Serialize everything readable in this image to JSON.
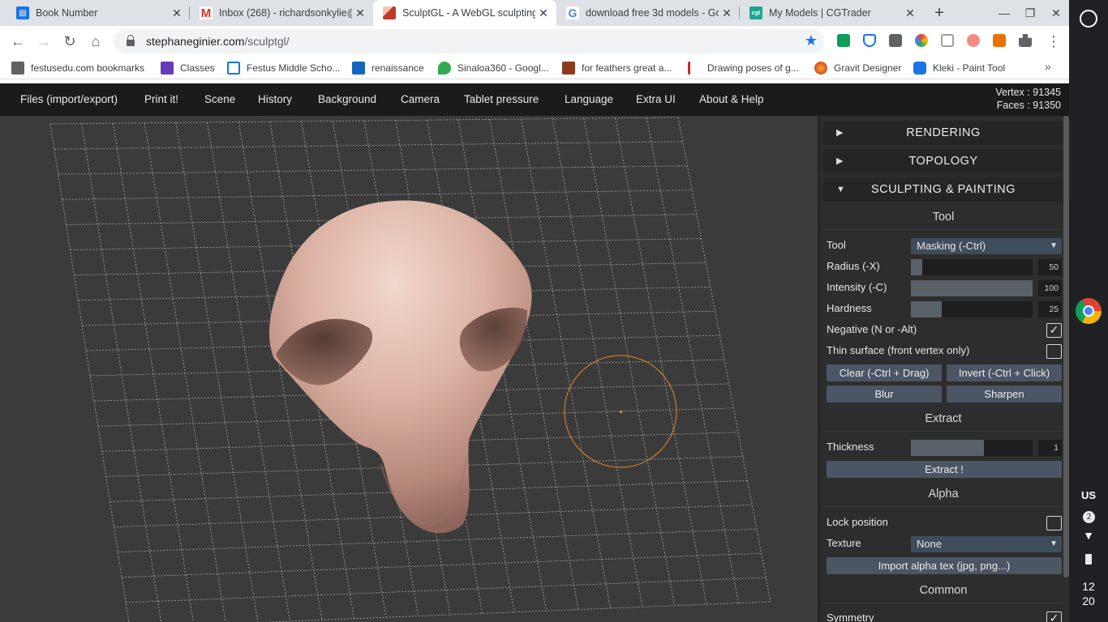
{
  "browser": {
    "tabs": [
      {
        "title": "Book Number",
        "favicon": "blue-doc-icon",
        "active": false
      },
      {
        "title": "Inbox (268) - richardsonkylie@",
        "favicon": "gmail-icon",
        "active": false
      },
      {
        "title": "SculptGL - A WebGL sculpting",
        "favicon": "sculptgl-icon",
        "active": true
      },
      {
        "title": "download free 3d models - Go",
        "favicon": "google-icon",
        "active": false
      },
      {
        "title": "My Models | CGTrader",
        "favicon": "cgtrader-icon",
        "active": false
      }
    ],
    "url_domain": "stephaneginier.com",
    "url_path": "/sculptgl/",
    "bookmarks": [
      {
        "label": "festusedu.com bookmarks",
        "icon": "folder-icon"
      },
      {
        "label": "Classes",
        "icon": "classroom-icon"
      },
      {
        "label": "Festus Middle Scho...",
        "icon": "calendar-icon"
      },
      {
        "label": "renaissance",
        "icon": "renaissance-icon"
      },
      {
        "label": "Sinaloa360 - Googl...",
        "icon": "maps-pin-icon"
      },
      {
        "label": "for feathers great a...",
        "icon": "image-icon"
      },
      {
        "label": "Drawing poses of g...",
        "icon": "figure-icon"
      },
      {
        "label": "Gravit Designer",
        "icon": "gravit-icon"
      },
      {
        "label": "Kleki - Paint Tool",
        "icon": "kleki-icon"
      }
    ]
  },
  "app": {
    "menu": [
      "Files (import/export)",
      "Print it!",
      "Scene",
      "History",
      "Background",
      "Camera",
      "Tablet pressure",
      "Language",
      "Extra UI",
      "About & Help"
    ],
    "stats": {
      "vertex": "Vertex : 91345",
      "faces": "Faces : 91350"
    },
    "panel": {
      "rendering": "RENDERING",
      "topology": "TOPOLOGY",
      "sculpting": "SCULPTING & PAINTING",
      "tool_header": "Tool",
      "tool_label": "Tool",
      "tool_value": "Masking (-Ctrl)",
      "radius_label": "Radius (-X)",
      "radius_value": "50",
      "radius_fraction": 0.09,
      "intensity_label": "Intensity (-C)",
      "intensity_value": "100",
      "intensity_fraction": 1.0,
      "hardness_label": "Hardness",
      "hardness_value": "25",
      "hardness_fraction": 0.25,
      "negative_label": "Negative (N or -Alt)",
      "negative_checked": true,
      "thin_label": "Thin surface (front vertex only)",
      "thin_checked": false,
      "clear_btn": "Clear (-Ctrl + Drag)",
      "invert_btn": "Invert (-Ctrl + Click)",
      "blur_btn": "Blur",
      "sharpen_btn": "Sharpen",
      "extract_header": "Extract",
      "thickness_label": "Thickness",
      "thickness_value": "1",
      "thickness_fraction": 0.6,
      "extract_btn": "Extract !",
      "alpha_header": "Alpha",
      "lock_label": "Lock position",
      "lock_checked": false,
      "texture_label": "Texture",
      "texture_value": "None",
      "import_btn": "Import alpha tex (jpg, png...)",
      "common_header": "Common",
      "symmetry_label": "Symmetry",
      "symmetry_checked": true
    }
  },
  "shelf": {
    "locale": "US",
    "notifications": "2",
    "time_hour": "12",
    "time_min": "20"
  },
  "colors": {
    "brush_circle": "#e8891f",
    "mesh": "#d9b3a3",
    "grid": "#a8a8a8",
    "accent": "#1a73e8"
  }
}
